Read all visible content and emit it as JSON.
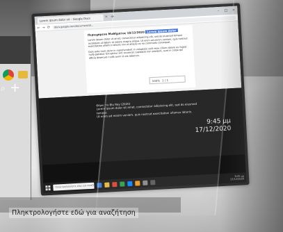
{
  "browser": {
    "tab_label": "Lorem ipsum dolor sit – Google Docs",
    "tab_close": "×",
    "new_tab": "+",
    "url": "docs.google.com/document/d/...",
    "back": "←",
    "forward": "→",
    "reload": "⟳",
    "controls": [
      "–",
      "□",
      "×"
    ]
  },
  "document": {
    "heading_prefix": "Περιεχόμενο Μαθήματος 18/12/2020",
    "heading_highlight": "Lorem ipsum dolor",
    "paragraphs": [
      "Lorem ipsum dolor sit amet, consectetur adipiscing elit, sed do eiusmod tempor incididunt ut labore et dolore magna aliqua. Ut enim ad minim veniam, quis nostrud exercitation ullamco laboris nisi ut aliquip ex ea commodo consequat.",
      "Duis aute irure dolor in reprehenderit in voluptate velit esse cillum dolore eu fugiat nulla pariatur. Excepteur sint occaecat cupidatat non proident, sunt in culpa qui officia deserunt mollit anim id est laborum."
    ]
  },
  "dark_note": {
    "lines": [
      "Θέμα: το Blu Ray (2020)",
      "Lorem ipsum dolor sit amet, consectetur adipiscing elit, sed do eiusmod tempor.",
      "Ut enim ad minim veniam, quis nostrud exercitation ullamco laboris."
    ]
  },
  "desktop": {
    "date": "17/12/2020",
    "time": "9:45 μμ"
  },
  "zoom": {
    "label": "100%",
    "page": "1 / 1"
  },
  "inner_taskbar": {
    "search_placeholder": "Πληκτρολογήστε εδώ για αναζήτηση",
    "tray_time": "9:45 μμ",
    "tray_date": "17/12/2020",
    "icon_colors": [
      "#3a7bd5",
      "#e6b93a",
      "#d44638",
      "#2aa24b",
      "#0a84ff",
      "#f09a20",
      "#8a8a8a",
      "#5c5c5c"
    ]
  },
  "outer_taskbar": {
    "search_placeholder": "Πληκτρολογήστε εδώ για αναζήτηση"
  }
}
